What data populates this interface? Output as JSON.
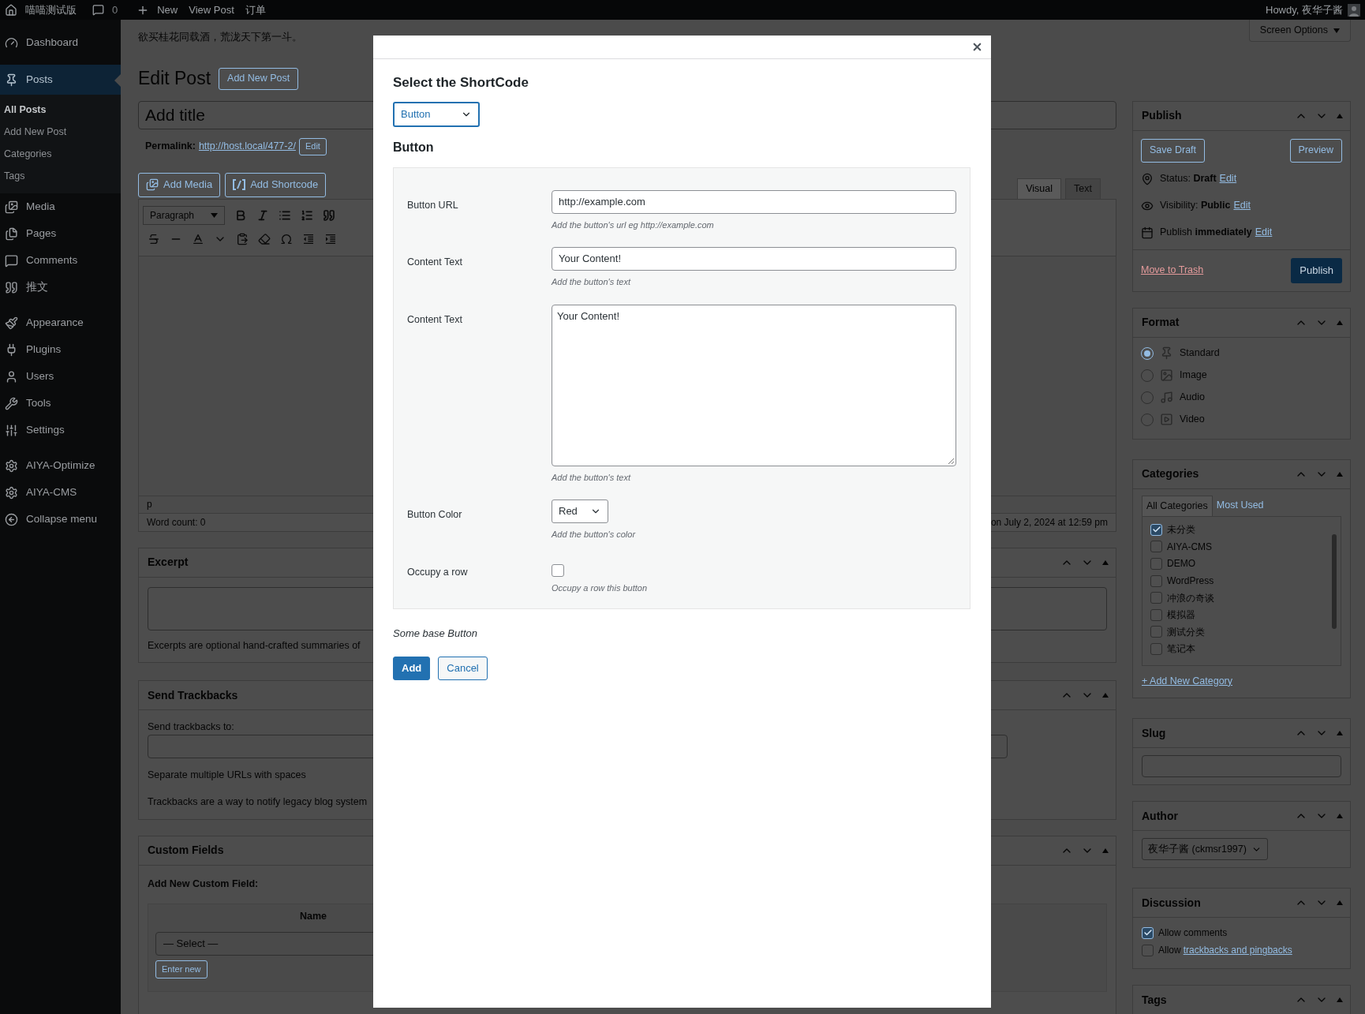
{
  "top_bar": {
    "site_name": "喵喵测试版",
    "comments_count": "0",
    "new": "New",
    "view_post": "View Post",
    "order": "订单",
    "howdy": "Howdy, 夜华子酱"
  },
  "sidebar": {
    "sections": [
      {
        "items": [
          {
            "label": "Dashboard",
            "selected": false
          }
        ]
      },
      {
        "items": [
          {
            "label": "Posts",
            "selected": true,
            "children": [
              {
                "label": "All Posts",
                "selected": true
              },
              {
                "label": "Add New Post",
                "selected": false
              },
              {
                "label": "Categories",
                "selected": false
              },
              {
                "label": "Tags",
                "selected": false
              }
            ]
          },
          {
            "label": "Media",
            "selected": false
          },
          {
            "label": "Pages",
            "selected": false
          },
          {
            "label": "Comments",
            "selected": false
          },
          {
            "label": "推文",
            "selected": false
          }
        ]
      },
      {
        "items": [
          {
            "label": "Appearance",
            "selected": false
          },
          {
            "label": "Plugins",
            "selected": false
          },
          {
            "label": "Users",
            "selected": false
          },
          {
            "label": "Tools",
            "selected": false
          },
          {
            "label": "Settings",
            "selected": false
          }
        ]
      },
      {
        "items": [
          {
            "label": "AIYA-Optimize",
            "selected": false
          },
          {
            "label": "AIYA-CMS",
            "selected": false
          },
          {
            "label": "Collapse menu",
            "selected": false
          }
        ]
      }
    ]
  },
  "notice": "欲买桂花同载酒，荒泷天下第一斗。",
  "screen_options": "Screen Options",
  "heading": "Edit Post",
  "add_new_button": "Add New Post",
  "title_placeholder": "Add title",
  "permalink": {
    "label": "Permalink:",
    "url": "http://host.local/477-2/",
    "edit": "Edit"
  },
  "media_buttons": [
    "Add Media",
    "Add Shortcode"
  ],
  "editor_tabs": [
    {
      "label": "Visual",
      "selected": true
    },
    {
      "label": "Text",
      "selected": false
    }
  ],
  "format_select": "Paragraph",
  "editor_status": {
    "path": "p",
    "word_count": "Word count: 0",
    "last_edited": "on July 2, 2024 at 12:59 pm"
  },
  "excerpt": {
    "title": "Excerpt",
    "hint": "Excerpts are optional hand-crafted summaries of"
  },
  "trackbacks": {
    "title": "Send Trackbacks",
    "label": "Send trackbacks to:",
    "hint": "Separate multiple URLs with spaces",
    "note": "Trackbacks are a way to notify legacy blog system"
  },
  "custom_fields": {
    "title": "Custom Fields",
    "label": "Add New Custom Field:",
    "column": "Name",
    "select": "— Select —",
    "enter_new": "Enter new"
  },
  "publish": {
    "title": "Publish",
    "save_draft": "Save Draft",
    "preview": "Preview",
    "rows": [
      {
        "label": "Status:",
        "value": "Draft",
        "link": "Edit"
      },
      {
        "label": "Visibility:",
        "value": "Public",
        "link": "Edit"
      },
      {
        "label": "Publish",
        "value": "immediately",
        "link": "Edit"
      }
    ],
    "trash": "Move to Trash",
    "publish_button": "Publish"
  },
  "format": {
    "title": "Format",
    "options": [
      {
        "label": "Standard",
        "selected": true
      },
      {
        "label": "Image",
        "selected": false
      },
      {
        "label": "Audio",
        "selected": false
      },
      {
        "label": "Video",
        "selected": false
      }
    ]
  },
  "categories": {
    "title": "Categories",
    "tabs": [
      {
        "label": "All Categories",
        "selected": true
      },
      {
        "label": "Most Used",
        "selected": false
      }
    ],
    "items": [
      {
        "label": "未分类",
        "checked": true
      },
      {
        "label": "AIYA-CMS",
        "checked": false
      },
      {
        "label": "DEMO",
        "checked": false
      },
      {
        "label": "WordPress",
        "checked": false
      },
      {
        "label": "冲浪の奇谈",
        "checked": false
      },
      {
        "label": "模拟器",
        "checked": false
      },
      {
        "label": "测试分类",
        "checked": false
      },
      {
        "label": "笔记本",
        "checked": false
      }
    ],
    "add_link": "+ Add New Category"
  },
  "slug": {
    "title": "Slug"
  },
  "author": {
    "title": "Author",
    "value": "夜华子酱 (ckmsr1997)"
  },
  "discussion": {
    "title": "Discussion",
    "options": [
      {
        "label": "Allow comments",
        "checked": true
      },
      {
        "label": "Allow",
        "link": "trackbacks and pingbacks",
        "checked": false
      }
    ]
  },
  "tags": {
    "title": "Tags"
  },
  "modal": {
    "title": "Select the ShortCode",
    "shortcode_select": "Button",
    "section_title": "Button",
    "fields": [
      {
        "kind": "text",
        "label": "Button URL",
        "value": "http://example.com",
        "hint": "Add the button's url eg http://example.com"
      },
      {
        "kind": "text",
        "label": "Content Text",
        "value": "Your Content!",
        "hint": "Add the button's text"
      },
      {
        "kind": "textarea",
        "label": "Content Text",
        "value": "Your Content!",
        "hint": "Add the button's text"
      },
      {
        "kind": "select",
        "label": "Button Color",
        "value": "Red",
        "hint": "Add the button's color"
      },
      {
        "kind": "checkbox",
        "label": "Occupy a row",
        "checked": false,
        "hint": "Occupy a row this button"
      }
    ],
    "note": "Some base Button",
    "buttons": [
      {
        "label": "Add",
        "kind": "primary"
      },
      {
        "label": "Cancel",
        "kind": "secondary"
      }
    ]
  }
}
